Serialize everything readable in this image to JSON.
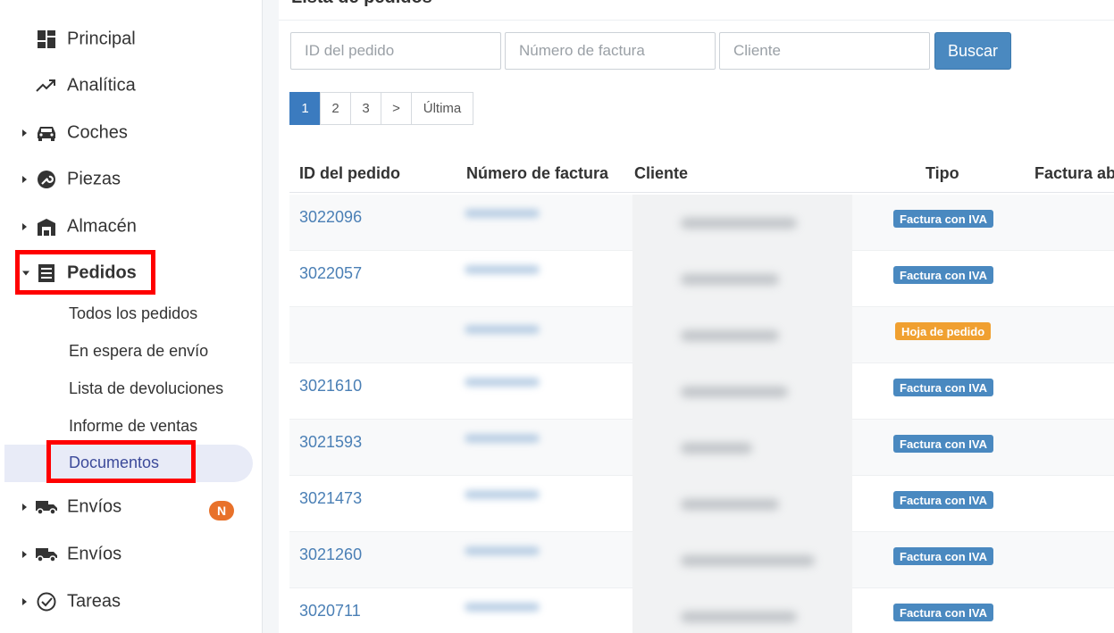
{
  "sidebar": {
    "items": [
      {
        "label": "Principal",
        "icon": "dashboard-icon"
      },
      {
        "label": "Analítica",
        "icon": "trending-up-icon"
      },
      {
        "label": "Coches",
        "icon": "car-icon"
      },
      {
        "label": "Piezas",
        "icon": "wrench-icon"
      },
      {
        "label": "Almacén",
        "icon": "warehouse-icon"
      },
      {
        "label": "Pedidos",
        "icon": "receipt-icon"
      },
      {
        "label": "Envíos",
        "icon": "truck-icon"
      },
      {
        "label": "Envíos",
        "icon": "truck-icon"
      },
      {
        "label": "Tareas",
        "icon": "check-circle-icon"
      }
    ],
    "pedidos_sub": [
      "Todos los pedidos",
      "En espera de envío",
      "Lista de devoluciones",
      "Informe de ventas",
      "Documentos"
    ],
    "envios_badge": "N"
  },
  "main": {
    "title": "Lista de pedidos",
    "search": {
      "order_id_placeholder": "ID del pedido",
      "invoice_placeholder": "Número de factura",
      "client_placeholder": "Cliente",
      "button": "Buscar"
    },
    "pagination": [
      "1",
      "2",
      "3",
      ">",
      "Última"
    ],
    "table": {
      "columns": [
        "ID del pedido",
        "Número de factura",
        "Cliente",
        "Tipo",
        "Factura abo"
      ],
      "rows": [
        {
          "id": "3022096",
          "tipo": "Factura con IVA"
        },
        {
          "id": "3022057",
          "tipo": "Factura con IVA"
        },
        {
          "id": "",
          "tipo": "Hoja de pedido"
        },
        {
          "id": "3021610",
          "tipo": "Factura con IVA"
        },
        {
          "id": "3021593",
          "tipo": "Factura con IVA"
        },
        {
          "id": "3021473",
          "tipo": "Factura con IVA"
        },
        {
          "id": "3021260",
          "tipo": "Factura con IVA"
        },
        {
          "id": "3020711",
          "tipo": "Factura con IVA"
        }
      ]
    }
  },
  "colors": {
    "accent": "#3b7bbf",
    "iva_badge": "#4a89c0",
    "pedido_badge": "#f0a030",
    "highlight": "#ff0000",
    "notification": "#e8712a"
  }
}
